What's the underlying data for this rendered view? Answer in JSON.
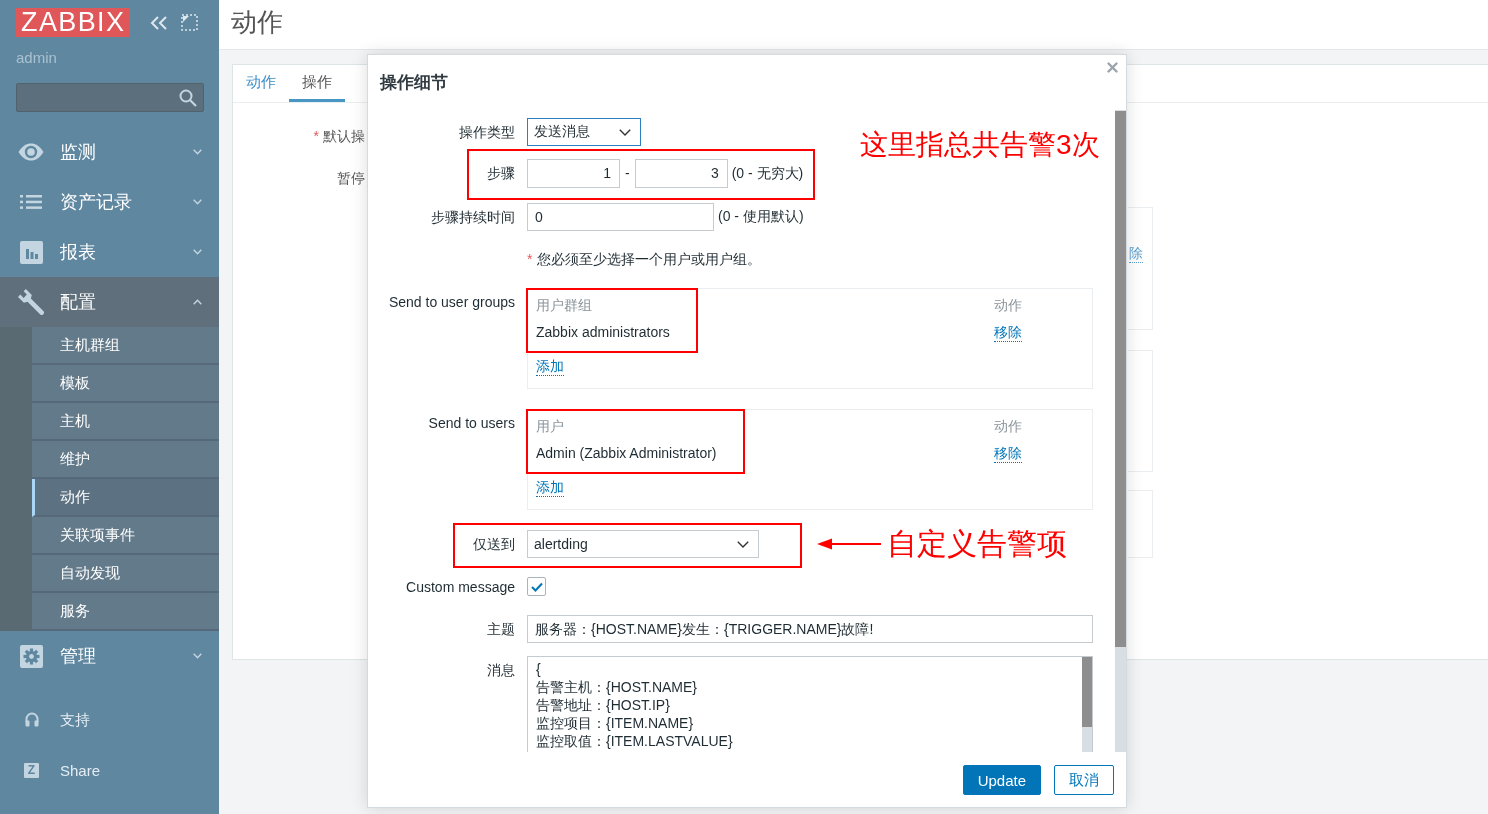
{
  "sidebar": {
    "logo": "ZABBIX",
    "user": "admin",
    "menu": [
      {
        "label": "监测",
        "expanded": false
      },
      {
        "label": "资产记录",
        "expanded": false
      },
      {
        "label": "报表",
        "expanded": false
      },
      {
        "label": "配置",
        "expanded": true,
        "children": [
          {
            "label": "主机群组",
            "selected": false
          },
          {
            "label": "模板",
            "selected": false
          },
          {
            "label": "主机",
            "selected": false
          },
          {
            "label": "维护",
            "selected": false
          },
          {
            "label": "动作",
            "selected": true
          },
          {
            "label": "关联项事件",
            "selected": false
          },
          {
            "label": "自动发现",
            "selected": false
          },
          {
            "label": "服务",
            "selected": false
          }
        ]
      },
      {
        "label": "管理",
        "expanded": false
      }
    ],
    "links": [
      {
        "label": "支持"
      },
      {
        "label": "Share",
        "logo": "Z"
      }
    ]
  },
  "page": {
    "title": "动作",
    "tabs": [
      {
        "label": "动作",
        "selected": false
      },
      {
        "label": "操作",
        "selected": true
      }
    ],
    "form_labels": [
      {
        "mark": "*",
        "text": "默认操"
      },
      {
        "text": "暂停"
      }
    ],
    "operations_column": {
      "link": "除"
    }
  },
  "dialog": {
    "title": "操作细节",
    "fields": [
      {
        "kind": "select",
        "label": "操作类型",
        "value": "发送消息",
        "focused": true
      },
      {
        "kind": "range",
        "label": "步骤",
        "from": "1",
        "separator": "-",
        "to": "3",
        "hint": "(0 - 无穷大)",
        "highlighted": true,
        "note": {
          "text": "这里指总共告警3次"
        }
      },
      {
        "kind": "text",
        "label": "步骤持续时间",
        "value": "0",
        "hint": "(0 - 使用默认)"
      },
      {
        "kind": "notice",
        "mark": "*",
        "text": "您必须至少选择一个用户或用户组。"
      },
      {
        "kind": "table",
        "label": "Send to user groups",
        "columns": [
          "用户群组",
          "动作"
        ],
        "rows": [
          {
            "name": "Zabbix administrators",
            "action": "移除"
          }
        ],
        "add": "添加",
        "highlighted": true
      },
      {
        "kind": "table",
        "label": "Send to users",
        "columns": [
          "用户",
          "动作"
        ],
        "rows": [
          {
            "name": "Admin (Zabbix Administrator)",
            "action": "移除"
          }
        ],
        "add": "添加",
        "highlighted": true
      },
      {
        "kind": "select",
        "label": "仅送到",
        "value": "alertding",
        "focused": false,
        "highlighted": true,
        "note": {
          "text": "自定义告警项",
          "arrow": true
        }
      },
      {
        "kind": "checkbox",
        "label": "Custom message",
        "checked": true
      },
      {
        "kind": "text",
        "label": "主题",
        "value": "服务器：{HOST.NAME}发生：{TRIGGER.NAME}故障!"
      },
      {
        "kind": "textarea",
        "label": "消息",
        "value": "{\n告警主机：{HOST.NAME}\n告警地址：{HOST.IP}\n监控项目：{ITEM.NAME}\n监控取值：{ITEM.LASTVALUE}"
      }
    ],
    "buttons": [
      {
        "label": "Update",
        "primary": true
      },
      {
        "label": "取消",
        "primary": false
      }
    ]
  }
}
